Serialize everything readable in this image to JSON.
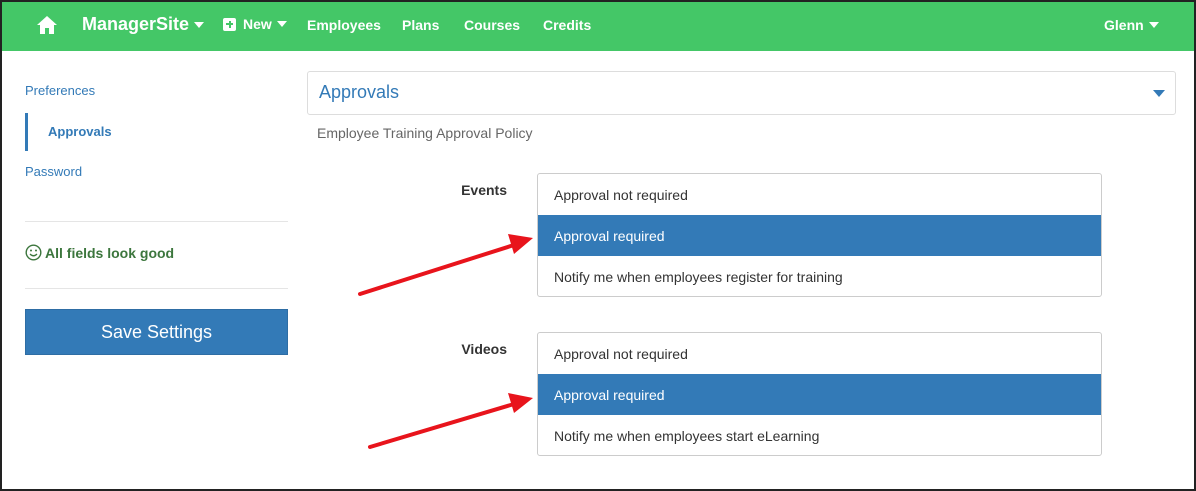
{
  "navbar": {
    "brand": "ManagerSite",
    "new_label": "New",
    "links": [
      "Employees",
      "Plans",
      "Courses",
      "Credits"
    ],
    "user": "Glenn",
    "bg_color": "#44c767"
  },
  "sidebar": {
    "items": [
      {
        "label": "Preferences",
        "active": false
      },
      {
        "label": "Approvals",
        "active": true
      },
      {
        "label": "Password",
        "active": false
      }
    ],
    "status": "All fields look good",
    "save_label": "Save Settings"
  },
  "main": {
    "panel_title": "Approvals",
    "policy_label": "Employee Training Approval Policy",
    "groups": [
      {
        "label": "Events",
        "options": [
          "Approval not required",
          "Approval required",
          "Notify me when employees register for training"
        ],
        "selected": "Approval required"
      },
      {
        "label": "Videos",
        "options": [
          "Approval not required",
          "Approval required",
          "Notify me when employees start eLearning"
        ],
        "selected": "Approval required"
      }
    ]
  },
  "colors": {
    "accent": "#337ab7",
    "annotation": "#e8141c",
    "success": "#3c763d"
  }
}
